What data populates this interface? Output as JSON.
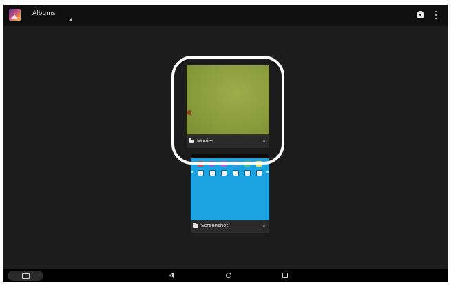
{
  "action_bar": {
    "app_icon": "gallery-app-icon",
    "title": "Albums",
    "actions": [
      {
        "icon": "camera-icon"
      },
      {
        "icon": "overflow-menu-icon"
      }
    ]
  },
  "albums": [
    {
      "name": "Movies",
      "icon": "folder-icon",
      "thumb_color": "#8a9b3c"
    },
    {
      "name": "Screenshot",
      "icon": "folder-icon",
      "thumb_color": "#1aa3e0"
    }
  ],
  "highlight": {
    "color": "#ffffff",
    "target": "Movies"
  },
  "nav_bar": {
    "buttons": [
      {
        "icon": "screenshot-capture-icon"
      },
      {
        "icon": "back-icon"
      },
      {
        "icon": "home-icon"
      },
      {
        "icon": "recents-icon"
      }
    ]
  },
  "screenshot_thumb": {
    "app_colors": [
      "#d84a4a",
      "#8c63d6",
      "#c85bd4",
      "#4c8fe0",
      "#4cc079",
      "#e8e046"
    ]
  }
}
